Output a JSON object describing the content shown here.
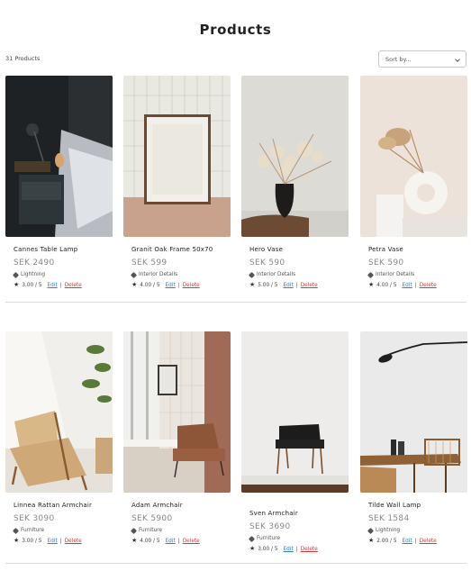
{
  "header": {
    "title": "Products"
  },
  "toolbar": {
    "count_text": "31 Products",
    "sort_label": "Sort by..."
  },
  "actions": {
    "edit_label": "Edit",
    "separator": "|",
    "delete_label": "Delete"
  },
  "products": [
    {
      "name": "Cannes Table Lamp",
      "price": "SEK 2490",
      "category": "Lightning",
      "rating": "3.00 / 5",
      "image": "bedside-lamp-photo"
    },
    {
      "name": "Granit Oak Frame 50x70",
      "price": "SEK 599",
      "category": "Interior Details",
      "rating": "4.00 / 5",
      "image": "oak-frame-photo"
    },
    {
      "name": "Hero Vase",
      "price": "SEK 590",
      "category": "Interior Details",
      "rating": "5.00 / 5",
      "image": "black-vase-photo"
    },
    {
      "name": "Petra Vase",
      "price": "SEK 590",
      "category": "Interior Details",
      "rating": "4.00 / 5",
      "image": "white-vase-photo"
    },
    {
      "name": "Linnea Rattan Armchair",
      "price": "SEK 3090",
      "category": "Furniture",
      "rating": "3.00 / 5",
      "image": "rattan-armchair-photo"
    },
    {
      "name": "Adam Armchair",
      "price": "SEK 5900",
      "category": "Furniture",
      "rating": "4.00 / 5",
      "image": "leather-armchair-photo"
    },
    {
      "name": "Sven Armchair",
      "price": "SEK 3690",
      "category": "Furniture",
      "rating": "3.00 / 5",
      "image": "black-armchair-photo"
    },
    {
      "name": "Tilde Wall Lamp",
      "price": "SEK 1584",
      "category": "Lightning",
      "rating": "2.00 / 5",
      "image": "wall-lamp-photo"
    }
  ]
}
